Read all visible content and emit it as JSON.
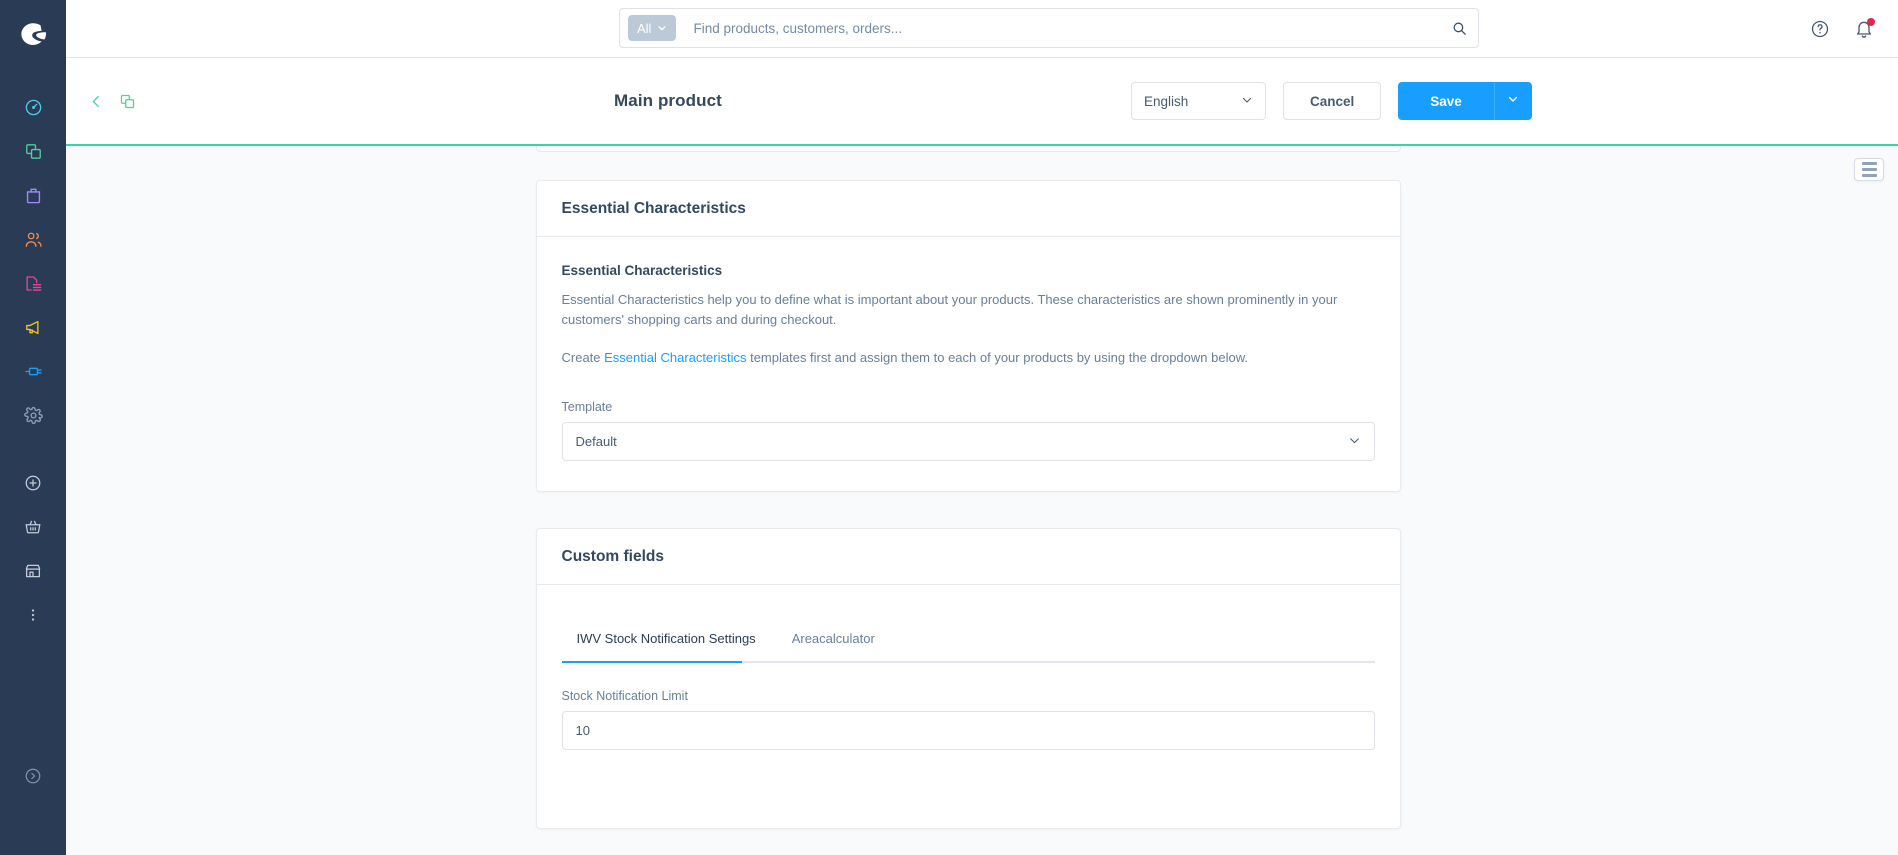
{
  "app": {
    "brand": "shopware",
    "accent_blue": "#189eff",
    "sidebar_bg": "#2a3c55",
    "success_green": "#37d8a0"
  },
  "sidebar": {
    "logo_name": "shopware-logo",
    "items": [
      {
        "name": "dashboard",
        "icon": "gauge-icon",
        "color": "#4ecbe6"
      },
      {
        "name": "catalogues",
        "icon": "copy-stack-icon",
        "color": "#4ecf9b"
      },
      {
        "name": "orders",
        "icon": "bag-icon",
        "color": "#a28aff"
      },
      {
        "name": "customers",
        "icon": "users-icon",
        "color": "#f08b4c"
      },
      {
        "name": "content",
        "icon": "content-page-icon",
        "color": "#e8439e"
      },
      {
        "name": "marketing",
        "icon": "megaphone-icon",
        "color": "#f5c518"
      },
      {
        "name": "extensions",
        "icon": "plug-icon",
        "color": "#189eff"
      },
      {
        "name": "settings",
        "icon": "gear-icon",
        "color": "#8fa2b7"
      }
    ],
    "shortcuts": [
      {
        "name": "add-new",
        "icon": "plus-circle-icon",
        "color": "#c3ccd8"
      },
      {
        "name": "storefront-basket",
        "icon": "basket-icon",
        "color": "#c3ccd8"
      },
      {
        "name": "sales-channel-store",
        "icon": "store-icon",
        "color": "#c3ccd8"
      },
      {
        "name": "more",
        "icon": "dots-vertical-icon",
        "color": "#c3ccd8"
      }
    ],
    "footer": {
      "name": "expand-sidebar",
      "icon": "chevron-right-circle-icon"
    }
  },
  "topbar": {
    "search": {
      "scope_label": "All",
      "scope_caret": "chevron-down-icon",
      "value": "",
      "placeholder": "Find products, customers, orders...",
      "search_icon": "search-icon"
    },
    "help_icon": "question-circle-icon",
    "notifications_icon": "bell-icon",
    "has_notification": true
  },
  "smartbar": {
    "back_icon": "chevron-left-icon",
    "duplicate_icon": "copy-stack-icon",
    "title": "Main product",
    "language": {
      "selected": "English",
      "caret": "chevron-down-icon"
    },
    "cancel_label": "Cancel",
    "save_label": "Save",
    "save_caret": "chevron-down-icon"
  },
  "content": {
    "list_toggle": {
      "name": "list-view-toggle",
      "icon": "list-icon"
    },
    "essential_characteristics_card": {
      "header": "Essential Characteristics",
      "section_title": "Essential Characteristics",
      "paragraph_1": "Essential Characteristics help you to define what is important about your products. These characteristics are shown prominently in your customers' shopping carts and during checkout.",
      "paragraph_2_before": "Create ",
      "paragraph_2_link": "Essential Characteristics",
      "paragraph_2_after": " templates first and assign them to each of your products by using the dropdown below.",
      "template_label": "Template",
      "template_value": "Default",
      "template_caret": "chevron-down-icon"
    },
    "custom_fields_card": {
      "header": "Custom fields",
      "tabs": [
        {
          "label": "IWV Stock Notification Settings",
          "active": true
        },
        {
          "label": "Areacalculator",
          "active": false
        }
      ],
      "stock_notification_limit_label": "Stock Notification Limit",
      "stock_notification_limit_value": "10"
    }
  }
}
